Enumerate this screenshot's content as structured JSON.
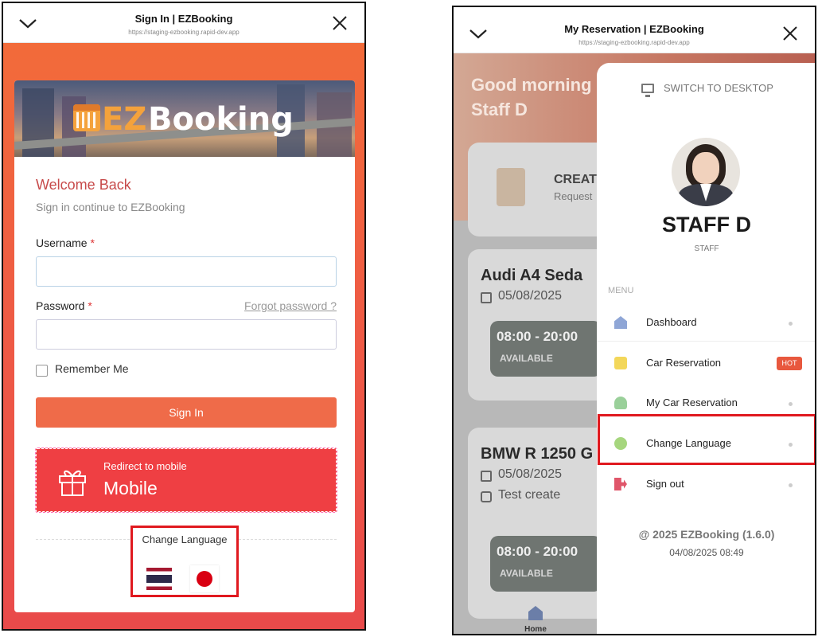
{
  "left": {
    "topbar": {
      "title": "Sign In | EZBooking",
      "url": "https://staging-ezbooking.rapid-dev.app"
    },
    "logo": {
      "ez": "EZ",
      "booking": "Booking"
    },
    "welcome": "Welcome Back",
    "subtitle": "Sign in continue to EZBooking",
    "username_label": "Username",
    "password_label": "Password",
    "required_mark": "*",
    "forgot": "Forgot password ?",
    "remember": "Remember Me",
    "signin": "Sign In",
    "redirect": {
      "small": "Redirect to mobile",
      "big": "Mobile"
    },
    "change_language": "Change Language",
    "icons": [
      "chevron-down-icon",
      "close-icon",
      "gift-icon",
      "thai-flag-icon",
      "japan-flag-icon"
    ]
  },
  "right": {
    "topbar": {
      "title": "My Reservation | EZBooking",
      "url": "https://staging-ezbooking.rapid-dev.app"
    },
    "greeting": [
      "Good morning",
      "Staff D"
    ],
    "create_card": {
      "title": "CREAT",
      "sub": "Request"
    },
    "cars": [
      {
        "name": "Audi A4 Seda",
        "date": "05/08/2025",
        "time": "08:00 - 20:00",
        "status": "AVAILABLE"
      },
      {
        "name": "BMW R 1250 G",
        "date": "05/08/2025",
        "note": "Test create",
        "time": "08:00 - 20:00",
        "status": "AVAILABLE"
      }
    ],
    "home_tab": "Home",
    "drawer": {
      "switch": "SWITCH TO DESKTOP",
      "name": "STAFF D",
      "role": "STAFF",
      "menu_header": "MENU",
      "items": [
        {
          "label": "Dashboard"
        },
        {
          "label": "Car Reservation",
          "badge": "HOT"
        },
        {
          "label": "My Car Reservation"
        },
        {
          "label": "Change Language"
        },
        {
          "label": "Sign out"
        }
      ],
      "copyright": "@ 2025 EZBooking (1.6.0)",
      "timestamp": "04/08/2025 08:49"
    },
    "colors": {
      "highlight": "#e0191f",
      "hot_badge": "#e8583e",
      "primary": "#ef6b49"
    }
  }
}
